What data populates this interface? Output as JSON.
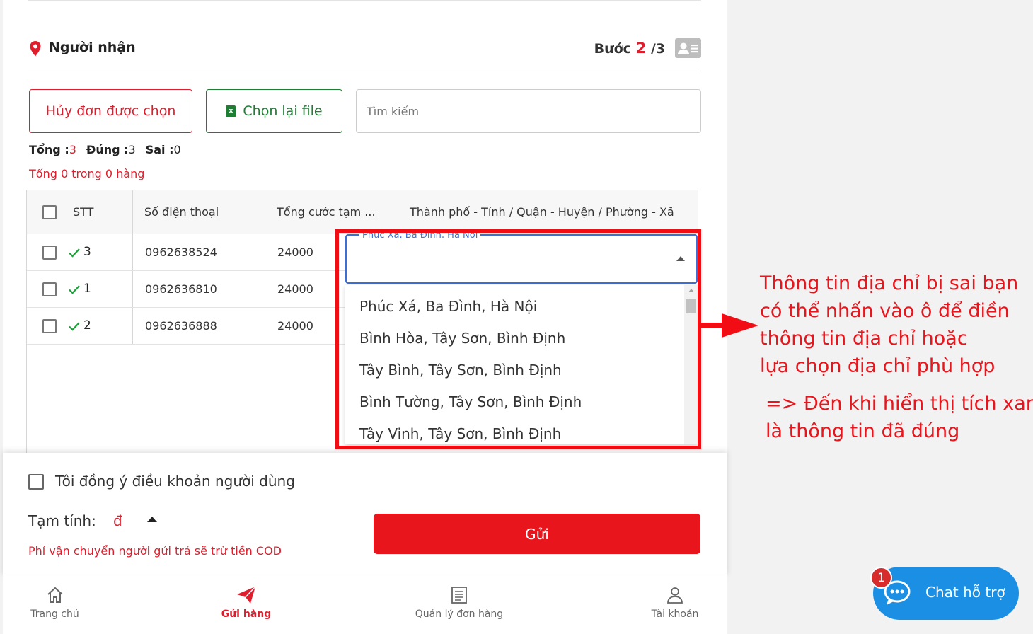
{
  "section": {
    "title": "Người nhận",
    "step_prefix": "Bước",
    "step_current": "2",
    "step_total": "/3"
  },
  "actions": {
    "cancel_selected": "Hủy đơn được chọn",
    "reselect_file": "Chọn lại file",
    "xls_icon_text": "x",
    "search_placeholder": "Tìm kiếm"
  },
  "summary": {
    "total_label": "Tổng :",
    "total_value": "3",
    "correct_label": "Đúng :",
    "correct_value": "3",
    "wrong_label": "Sai :",
    "wrong_value": "0",
    "total_line": "Tổng 0 trong 0 hàng"
  },
  "table": {
    "headers": [
      "STT",
      "Số điện thoại",
      "Tổng cước tạm ...",
      "Thành phố - Tỉnh / Quận - Huyện / Phường - Xã"
    ],
    "rows": [
      {
        "stt": "3",
        "phone": "0962638524",
        "fee": "24000"
      },
      {
        "stt": "1",
        "phone": "0962636810",
        "fee": "24000"
      },
      {
        "stt": "2",
        "phone": "0962636888",
        "fee": "24000"
      }
    ]
  },
  "address_dropdown": {
    "label": "Phúc Xá, Ba Đình, Hà Nội",
    "options": [
      "Phúc Xá, Ba Đình, Hà Nội",
      "Bình Hòa, Tây Sơn, Bình Định",
      "Tây Bình, Tây Sơn, Bình Định",
      "Bình Tường, Tây Sơn, Bình Định",
      "Tây Vinh, Tây Sơn, Bình Định"
    ]
  },
  "annotation": {
    "lines": [
      "Thông tin địa chỉ bị sai bạn",
      "có thể nhấn vào ô để điền",
      "thông tin địa chỉ hoặc",
      "lựa chọn địa chỉ phù hợp"
    ],
    "note_lines": [
      "=> Đến khi hiển thị tích xanh",
      "là thông tin đã đúng"
    ]
  },
  "footer": {
    "agree_terms": "Tôi đồng ý điều khoản người dùng",
    "estimate_label": "Tạm tính:",
    "currency": "đ",
    "shipping_note": "Phí vận chuyển người gửi trả sẽ trừ tiền COD",
    "send_button": "Gửi"
  },
  "bottom_nav": {
    "home": "Trang chủ",
    "send": "Gửi hàng",
    "orders": "Quản lý đơn hàng",
    "account": "Tài khoản"
  },
  "chat": {
    "label": "Chat hỗ trợ",
    "badge": "1"
  },
  "colors": {
    "brand_red": "#e01d2c",
    "success_green": "#1e7e34",
    "focus_blue": "#3a6fd8",
    "chat_blue": "#1b8fe4",
    "annotation_red": "#e8151c"
  },
  "icons": [
    "location-pin-icon",
    "contact-card-icon",
    "excel-file-icon",
    "checkmark-icon",
    "triangle-up-icon",
    "home-icon",
    "paper-plane-icon",
    "document-list-icon",
    "user-icon",
    "chat-bubble-icon"
  ]
}
